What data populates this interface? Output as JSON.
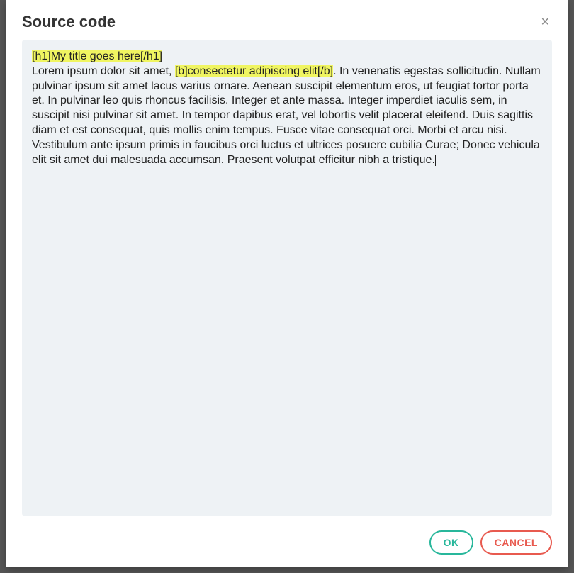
{
  "modal": {
    "title": "Source code",
    "close_label": "×"
  },
  "source": {
    "hl1": " [h1]My title goes here[/h1] ",
    "line2_pre": "Lorem ipsum dolor sit amet, ",
    "hl2": "[b]consectetur adipiscing elit[/b]",
    "rest": ". In venenatis egestas sollicitudin. Nullam pulvinar ipsum sit amet lacus varius ornare. Aenean suscipit elementum eros, ut feugiat tortor porta et. In pulvinar leo quis rhoncus facilisis. Integer et ante massa. Integer imperdiet iaculis sem, in suscipit nisi pulvinar sit amet. In tempor dapibus erat, vel lobortis velit placerat eleifend. Duis sagittis diam et est consequat, quis mollis enim tempus. Fusce vitae consequat orci. Morbi et arcu nisi. Vestibulum ante ipsum primis in faucibus orci luctus et ultrices posuere cubilia Curae; Donec vehicula elit sit amet dui malesuada accumsan. Praesent volutpat efficitur nibh a tristique."
  },
  "footer": {
    "ok_label": "OK",
    "cancel_label": "CANCEL"
  }
}
